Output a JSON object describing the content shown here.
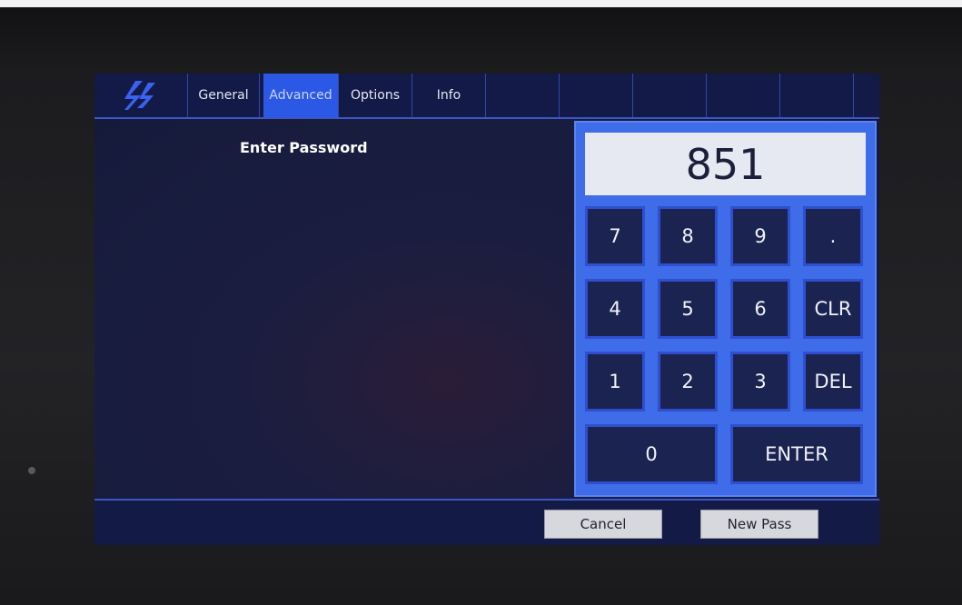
{
  "tabs": [
    {
      "label": "General"
    },
    {
      "label": "Advanced"
    },
    {
      "label": "Options"
    },
    {
      "label": "Info"
    }
  ],
  "active_tab": "Advanced",
  "logo_icon": "brand-logo-icon",
  "prompt": "Enter Password",
  "display_value": "851",
  "keys": {
    "k7": "7",
    "k8": "8",
    "k9": "9",
    "dot": ".",
    "k4": "4",
    "k5": "5",
    "k6": "6",
    "clr": "CLR",
    "k1": "1",
    "k2": "2",
    "k3": "3",
    "del": "DEL",
    "k0": "0",
    "enter": "ENTER"
  },
  "buttons": {
    "cancel": "Cancel",
    "new_pass": "New Pass"
  },
  "colors": {
    "accent": "#2c58e6",
    "keypad": "#3f6ce8",
    "screen_bg": "#171b3c"
  }
}
